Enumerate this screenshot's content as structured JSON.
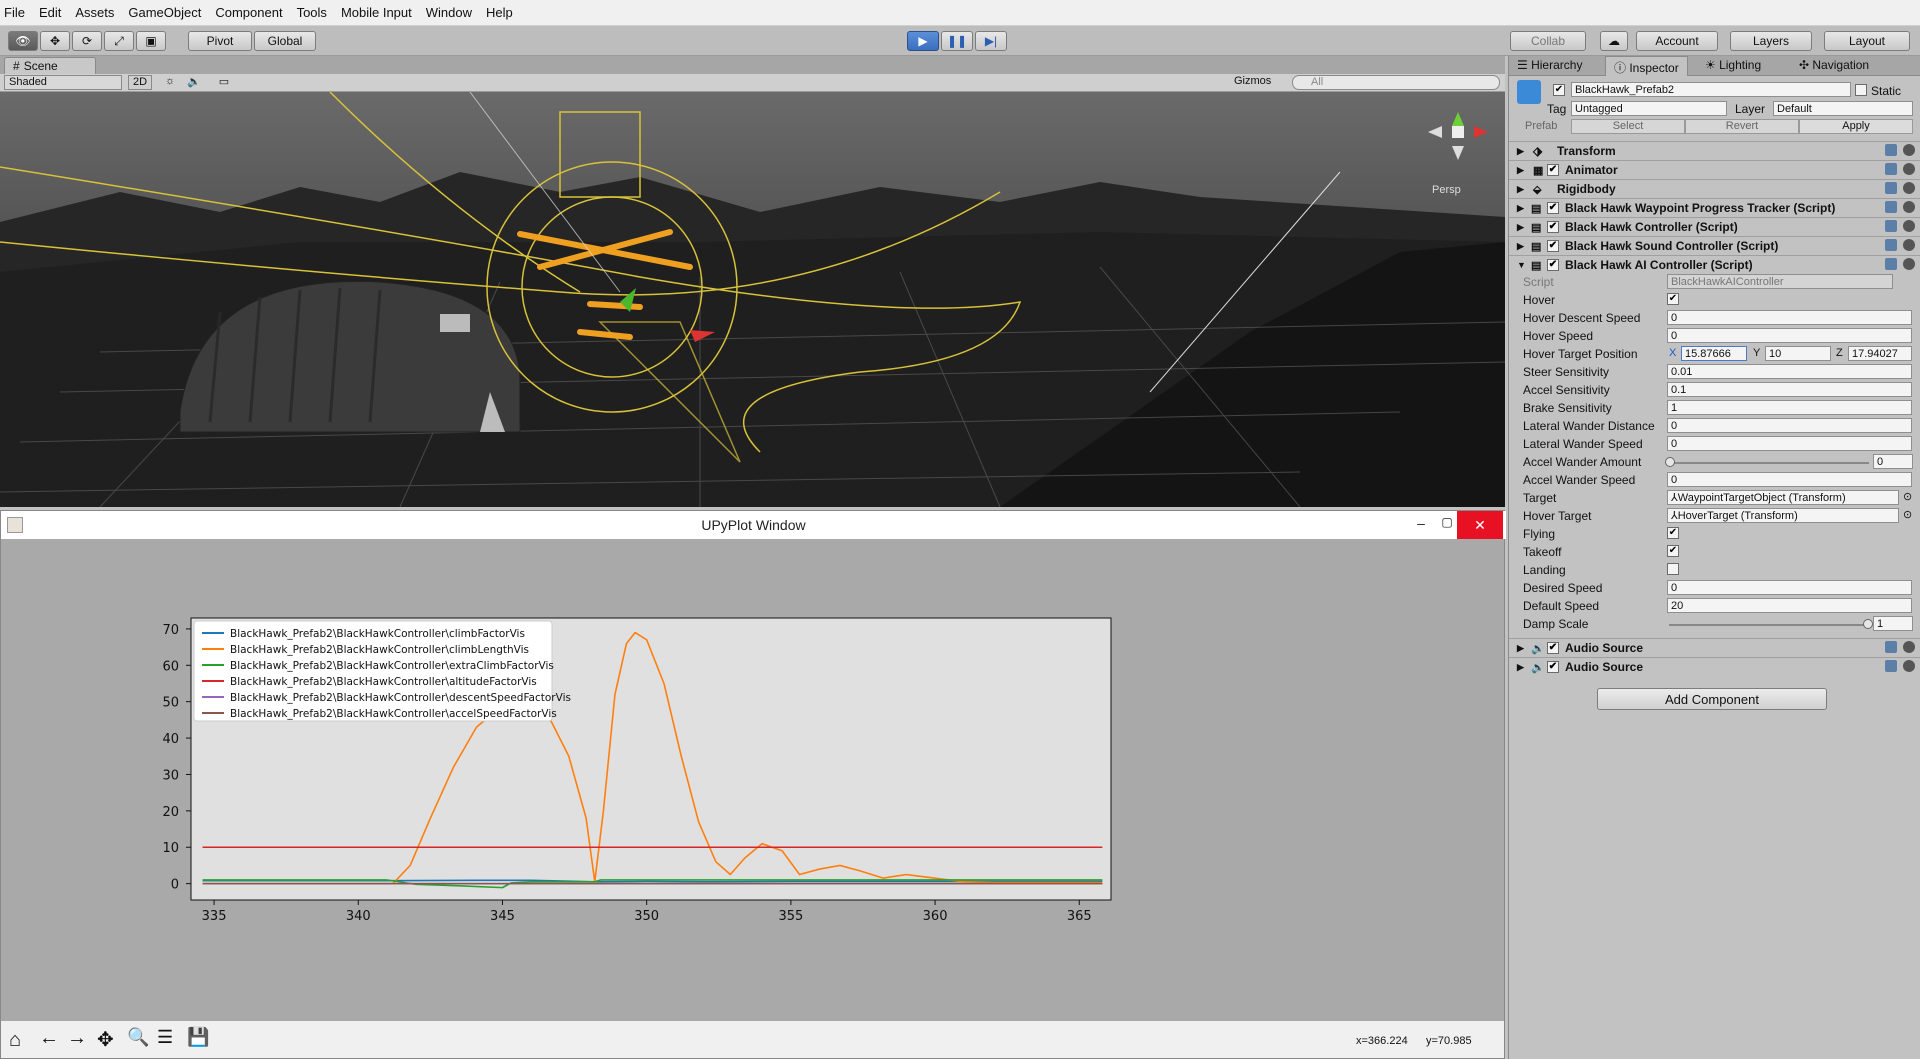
{
  "menu": [
    "File",
    "Edit",
    "Assets",
    "GameObject",
    "Component",
    "Tools",
    "Mobile Input",
    "Window",
    "Help"
  ],
  "toolbar": {
    "pivot": "Pivot",
    "global": "Global",
    "collab": "Collab",
    "account": "Account",
    "layers": "Layers",
    "layout": "Layout"
  },
  "scene": {
    "tab": "Scene",
    "shading": "Shaded",
    "mode2d": "2D",
    "gizmos": "Gizmos",
    "search_placeholder": "All",
    "persp": "Persp"
  },
  "plot_window": {
    "title": "UPyPlot Window",
    "coords": {
      "x": "x=366.224",
      "y": "y=70.985"
    }
  },
  "panel_tabs": [
    "Hierarchy",
    "Inspector",
    "Lighting",
    "Navigation"
  ],
  "inspector": {
    "object_name": "BlackHawk_Prefab2",
    "static_label": "Static",
    "tag_label": "Tag",
    "tag_value": "Untagged",
    "layer_label": "Layer",
    "layer_value": "Default",
    "prefab_label": "Prefab",
    "prefab_select": "Select",
    "prefab_revert": "Revert",
    "prefab_apply": "Apply",
    "components": [
      "Transform",
      "Animator",
      "Rigidbody",
      "Black Hawk Waypoint Progress Tracker (Script)",
      "Black Hawk Controller (Script)",
      "Black Hawk Sound Controller (Script)",
      "Black Hawk AI Controller (Script)"
    ],
    "fields": {
      "script": {
        "label": "Script",
        "value": "BlackHawkAIController"
      },
      "hover": {
        "label": "Hover"
      },
      "hover_descent_speed": {
        "label": "Hover Descent Speed",
        "value": "0"
      },
      "hover_speed": {
        "label": "Hover Speed",
        "value": "0"
      },
      "hover_target_position": {
        "label": "Hover Target Position",
        "x": "15.87666",
        "y": "10",
        "z": "17.94027"
      },
      "steer_sensitivity": {
        "label": "Steer Sensitivity",
        "value": "0.01"
      },
      "accel_sensitivity": {
        "label": "Accel Sensitivity",
        "value": "0.1"
      },
      "brake_sensitivity": {
        "label": "Brake Sensitivity",
        "value": "1"
      },
      "lateral_wander_distance": {
        "label": "Lateral Wander Distance",
        "value": "0"
      },
      "lateral_wander_speed": {
        "label": "Lateral Wander Speed",
        "value": "0"
      },
      "accel_wander_amount": {
        "label": "Accel Wander Amount",
        "value": "0"
      },
      "accel_wander_speed": {
        "label": "Accel Wander Speed",
        "value": "0"
      },
      "target": {
        "label": "Target",
        "value": "WaypointTargetObject (Transform)"
      },
      "hover_target": {
        "label": "Hover Target",
        "value": "HoverTarget (Transform)"
      },
      "flying": {
        "label": "Flying"
      },
      "takeoff": {
        "label": "Takeoff"
      },
      "landing": {
        "label": "Landing"
      },
      "desired_speed": {
        "label": "Desired Speed",
        "value": "0"
      },
      "default_speed": {
        "label": "Default Speed",
        "value": "20"
      },
      "damp_scale": {
        "label": "Damp Scale",
        "value": "1"
      }
    },
    "audio1": "Audio Source",
    "audio2": "Audio Source",
    "add_component": "Add Component",
    "xyz": {
      "x": "X",
      "y": "Y",
      "z": "Z"
    }
  },
  "chart_data": {
    "type": "line",
    "xlim": [
      334.2,
      366.1
    ],
    "ylim": [
      -4.5,
      73
    ],
    "xticks": [
      335,
      340,
      345,
      350,
      355,
      360,
      365
    ],
    "yticks": [
      0,
      10,
      20,
      30,
      40,
      50,
      60,
      70
    ],
    "legend_placement": "top-left",
    "series": [
      {
        "name": "BlackHawk_Prefab2\\BlackHawkController\\climbFactorVis",
        "color": "#1f77b4",
        "x": [
          334.6,
          341,
          344,
          346,
          348.2,
          350,
          352,
          355,
          360,
          365.8
        ],
        "y": [
          0.8,
          0.8,
          0.9,
          0.9,
          0.5,
          0.6,
          0.5,
          0.6,
          0.6,
          0.6
        ]
      },
      {
        "name": "BlackHawk_Prefab2\\BlackHawkController\\climbLengthVis",
        "color": "#ff7f0e",
        "x": [
          334.6,
          341.2,
          341.8,
          342.5,
          343.3,
          344.1,
          345,
          345.8,
          346.6,
          347.3,
          347.9,
          348.2,
          348.5,
          348.9,
          349.3,
          349.6,
          350,
          350.6,
          351.2,
          351.8,
          352.4,
          352.9,
          353.4,
          354,
          354.7,
          355.3,
          356,
          356.7,
          357.4,
          358.2,
          359,
          360,
          361,
          362,
          365.8
        ],
        "y": [
          0,
          0,
          5,
          18,
          32,
          43,
          49,
          50,
          46,
          35,
          18,
          0.5,
          20,
          52,
          66,
          69,
          67,
          55,
          35,
          17,
          6,
          2.5,
          7,
          11,
          9,
          2.5,
          4,
          5,
          3.5,
          1.5,
          2.5,
          1.5,
          0.5,
          0.3,
          0.3
        ]
      },
      {
        "name": "BlackHawk_Prefab2\\BlackHawkController\\extraClimbFactorVis",
        "color": "#2ca02c",
        "x": [
          334.6,
          341,
          342,
          343.5,
          345,
          345.3,
          346,
          348.2,
          348.4,
          350,
          355,
          360,
          365.8
        ],
        "y": [
          1,
          1,
          -0.2,
          -0.6,
          -1.1,
          0.2,
          0.5,
          0.5,
          1,
          1,
          1,
          1,
          1
        ]
      },
      {
        "name": "BlackHawk_Prefab2\\BlackHawkController\\altitudeFactorVis",
        "color": "#d62728",
        "x": [
          334.6,
          365.8
        ],
        "y": [
          10,
          10
        ]
      },
      {
        "name": "BlackHawk_Prefab2\\BlackHawkController\\descentSpeedFactorVis",
        "color": "#9467bd",
        "x": [
          334.6,
          365.8
        ],
        "y": [
          0,
          0
        ]
      },
      {
        "name": "BlackHawk_Prefab2\\BlackHawkController\\accelSpeedFactorVis",
        "color": "#8c564b",
        "x": [
          334.6,
          365.8
        ],
        "y": [
          0,
          0
        ]
      }
    ]
  }
}
